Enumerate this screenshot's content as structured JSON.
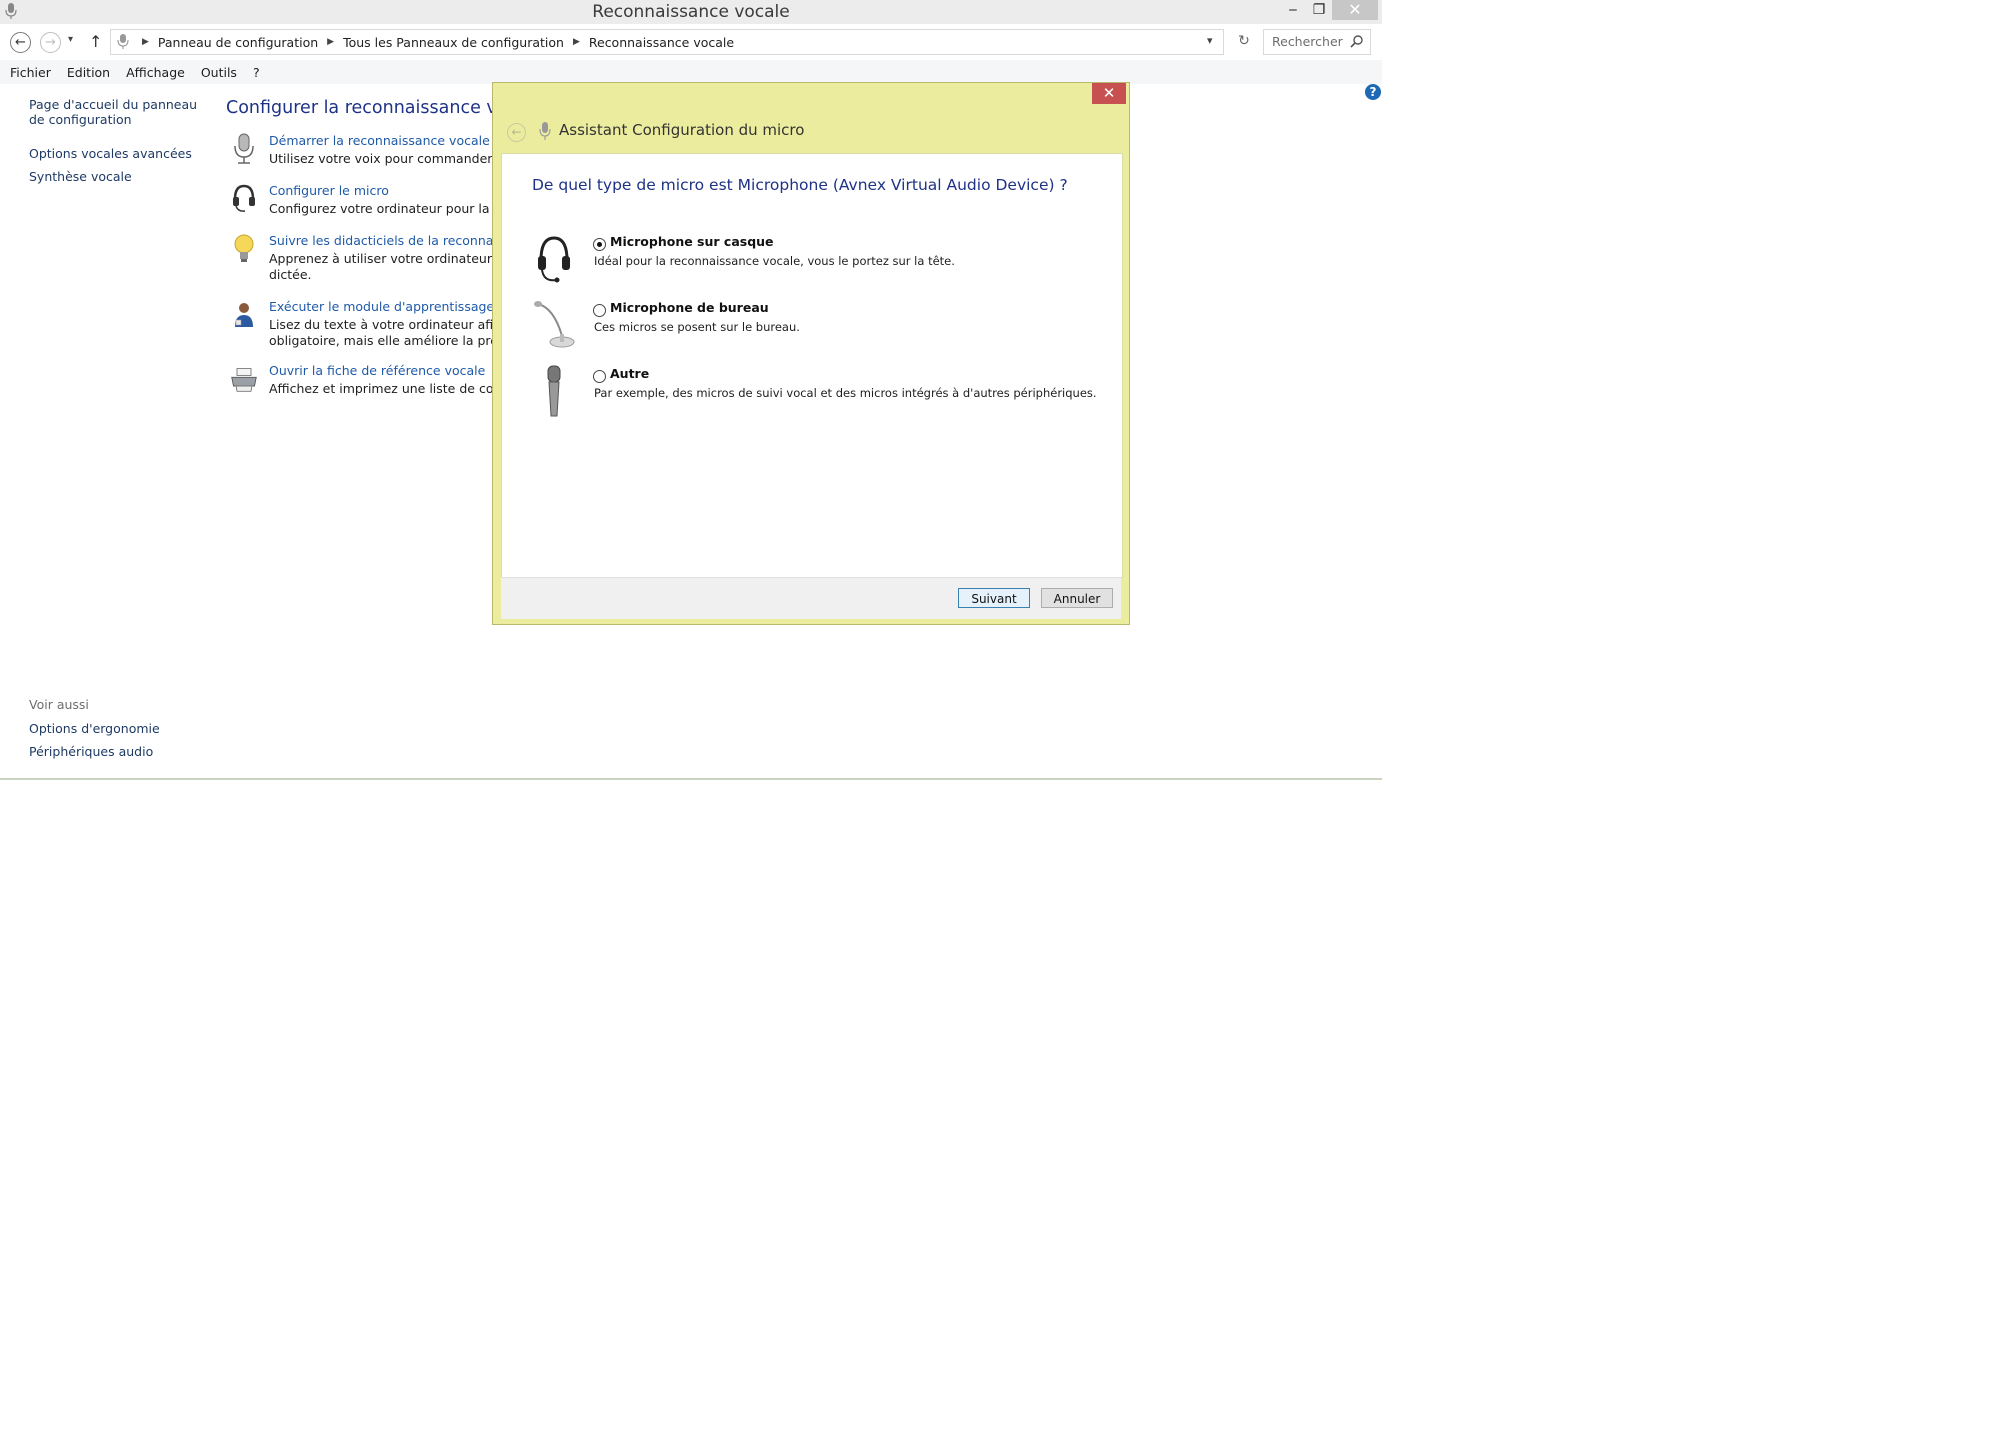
{
  "window": {
    "title": "Reconnaissance vocale",
    "controls": {
      "minimize": "‒",
      "maximize": "❐",
      "close": "✕"
    }
  },
  "navigation": {
    "breadcrumbs": [
      "Panneau de configuration",
      "Tous les Panneaux de configuration",
      "Reconnaissance vocale"
    ],
    "search_placeholder": "Rechercher"
  },
  "menu": [
    "Fichier",
    "Edition",
    "Affichage",
    "Outils",
    "?"
  ],
  "left_pane": {
    "home_link": "Page d'accueil du panneau de configuration",
    "links": [
      "Options vocales avancées",
      "Synthèse vocale"
    ],
    "see_also_heading": "Voir aussi",
    "see_also": [
      "Options d'ergonomie",
      "Périphériques audio"
    ]
  },
  "main": {
    "title": "Configurer la reconnaissance vocale",
    "tasks": [
      {
        "icon": "microphone-icon",
        "link": "Démarrer la reconnaissance vocale",
        "desc": [
          "Utilisez votre voix pour commander votre"
        ]
      },
      {
        "icon": "headset-icon",
        "link": "Configurer le micro",
        "desc": [
          "Configurez votre ordinateur pour la recon"
        ]
      },
      {
        "icon": "lightbulb-icon",
        "link": "Suivre les didacticiels de la reconnaissance",
        "desc": [
          "Apprenez à utiliser votre ordinateur avec la",
          "dictée."
        ]
      },
      {
        "icon": "user-training-icon",
        "link": "Exécuter le module d'apprentissage de vot",
        "desc": [
          "Lisez du texte à votre ordinateur afin que c",
          "obligatoire, mais elle améliore la précision"
        ]
      },
      {
        "icon": "printer-icon",
        "link": "Ouvrir la fiche de référence vocale",
        "desc": [
          "Affichez et imprimez une liste de comman"
        ]
      }
    ]
  },
  "dialog": {
    "title": "Assistant Configuration du micro",
    "close": "✕",
    "back": "←",
    "heading": "De quel type de micro est Microphone (Avnex Virtual Audio Device) ?",
    "options": [
      {
        "label": "Microphone sur casque",
        "desc": "Idéal pour la reconnaissance vocale, vous le portez sur la tête.",
        "selected": true,
        "icon": "headset-mic-icon"
      },
      {
        "label": "Microphone de bureau",
        "desc": "Ces micros se posent sur le bureau.",
        "selected": false,
        "icon": "desk-mic-icon"
      },
      {
        "label": "Autre",
        "desc": "Par exemple, des micros de suivi vocal et des micros intégrés à d'autres périphériques.",
        "selected": false,
        "icon": "handheld-mic-icon"
      }
    ],
    "buttons": {
      "next": "Suivant",
      "cancel": "Annuler"
    }
  },
  "colors": {
    "dialog_frame": "#ecec9f",
    "link": "#1e5aa8",
    "heading": "#1e3287",
    "close_red": "#c75050"
  }
}
